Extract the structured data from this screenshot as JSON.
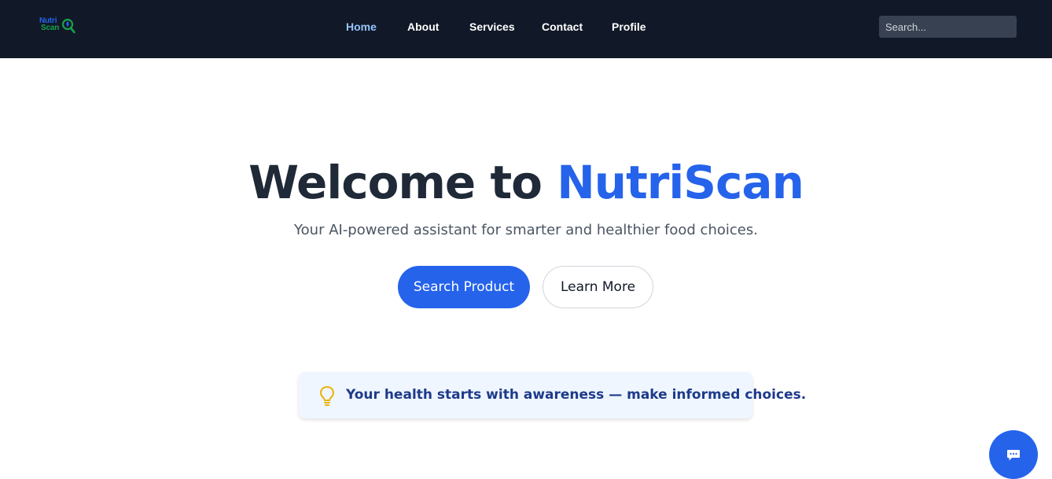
{
  "brand": {
    "line1": "Nutri",
    "line2": "Scan"
  },
  "nav": {
    "items": [
      {
        "label": "Home",
        "active": true
      },
      {
        "label": "About",
        "active": false
      },
      {
        "label": "Services",
        "active": false
      },
      {
        "label": "Contact",
        "active": false
      },
      {
        "label": "Profile",
        "active": false
      }
    ],
    "search_placeholder": "Search..."
  },
  "hero": {
    "title_prefix": "Welcome to ",
    "title_brand": "NutriScan",
    "subtitle": "Your AI-powered assistant for smarter and healthier food choices.",
    "primary_button": "Search Product",
    "secondary_button": "Learn More"
  },
  "tip": {
    "icon": "lightbulb-icon",
    "text": "Your health starts with awareness — make informed choices."
  },
  "chat": {
    "icon": "chat-icon"
  },
  "colors": {
    "navbar": "#111827",
    "accent": "#2563eb",
    "nav_active": "#93c5fd",
    "tip_bg": "#eff6ff",
    "tip_text": "#1e3a8a",
    "bulb": "#eab308"
  }
}
